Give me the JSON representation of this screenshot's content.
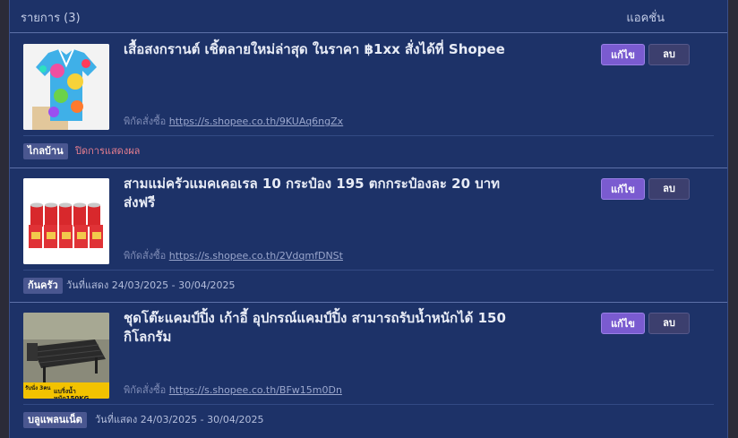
{
  "header": {
    "title": "รายการ (3)",
    "actions": "แอคชั่น"
  },
  "items": [
    {
      "title": "เสื้อสงกรานต์ เชิ้ตลายใหม่ล่าสุด ในราคา ฿1xx สั่งได้ที่ Shopee",
      "link_label": "พิกัดสั่งซื้อ",
      "url": "https://s.shopee.co.th/9KUAq6ngZx",
      "edit_label": "แก้ไข",
      "delete_label": "ลบ",
      "category": "ไกลบ้าน",
      "status": "ปิดการแสดงผล",
      "status_color": "#e87f8f",
      "thumb_icon": "colorful-shirt-photo"
    },
    {
      "title": "สามแม่ครัวแมคเคอเรล 10 กระป๋อง 195 ตกกระป๋องละ 20 บาท ส่งฟรี",
      "link_label": "พิกัดสั่งซื้อ",
      "url": "https://s.shopee.co.th/2VdqmfDNSt",
      "edit_label": "แก้ไข",
      "delete_label": "ลบ",
      "category": "ก้นครัว",
      "status": "วันที่แสดง 24/03/2025 - 30/04/2025",
      "thumb_icon": "canned-fish-photo"
    },
    {
      "title": "ชุดโต๊ะแคมป์ปิ้ง เก้าอี้ อุปกรณ์แคมป์ปิ้ง สามารถรับน้ำหนักได้ 150 กิโลกรัม",
      "link_label": "พิกัดสั่งซื้อ",
      "url": "https://s.shopee.co.th/BFw15m0Dn",
      "edit_label": "แก้ไข",
      "delete_label": "ลบ",
      "category": "บลูแพลนเน็ต",
      "status": "วันที่แสดง 24/03/2025 - 30/04/2025",
      "thumb_icon": "camping-table-photo",
      "thumb_text_left": "รับนั่ง 3คน",
      "thumb_text_right": "แบริ่งน้ำหนัก150KG"
    }
  ],
  "colors": {
    "panel": "#1d3268",
    "edit_button": "#7a5bd0",
    "delete_button": "#3c3f6e",
    "tag": "#4a5790"
  }
}
